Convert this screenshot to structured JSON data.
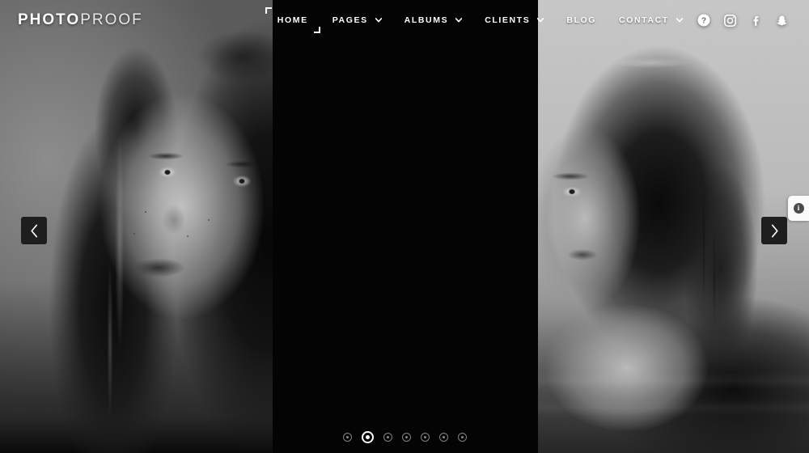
{
  "site": {
    "logo_bold": "PHOTO",
    "logo_thin": "PROOF"
  },
  "nav": {
    "items": [
      {
        "label": "HOME",
        "active": true,
        "has_dropdown": false,
        "icon": "home-brackets"
      },
      {
        "label": "PAGES",
        "active": false,
        "has_dropdown": true,
        "icon": "chevron-down-icon"
      },
      {
        "label": "ALBUMS",
        "active": false,
        "has_dropdown": true,
        "icon": "chevron-down-icon"
      },
      {
        "label": "CLIENTS",
        "active": false,
        "has_dropdown": true,
        "icon": "chevron-down-icon"
      },
      {
        "label": "BLOG",
        "active": false,
        "has_dropdown": false,
        "icon": ""
      },
      {
        "label": "CONTACT",
        "active": false,
        "has_dropdown": true,
        "icon": "chevron-down-icon"
      }
    ]
  },
  "social": {
    "items": [
      {
        "name": "help-icon",
        "title": "Help"
      },
      {
        "name": "instagram-icon",
        "title": "Instagram"
      },
      {
        "name": "facebook-icon",
        "title": "Facebook"
      },
      {
        "name": "snapchat-icon",
        "title": "Snapchat"
      }
    ]
  },
  "slider": {
    "prev_label": "‹",
    "next_label": "›",
    "prev_icon": "chevron-left-icon",
    "next_icon": "chevron-right-icon",
    "dot_count": 7,
    "active_dot": 2,
    "panels": [
      {
        "name": "slide-panel-left",
        "alt": "Black and white portrait of a woman with freckles in front of a concrete wall"
      },
      {
        "name": "slide-panel-center",
        "alt": "Black placeholder panel"
      },
      {
        "name": "slide-panel-right",
        "alt": "Black and white portrait of a woman with wet hair in water"
      }
    ]
  },
  "info_tab": {
    "name": "info-tab",
    "glyph": "i",
    "title": "Info"
  },
  "colors": {
    "background": "#000000",
    "header_text": "#ffffff",
    "arrow_bg": "#1e1e1e",
    "info_tab_bg": "#fafafa",
    "dot_active": "#ffffff",
    "dot_inactive": "#969696"
  }
}
